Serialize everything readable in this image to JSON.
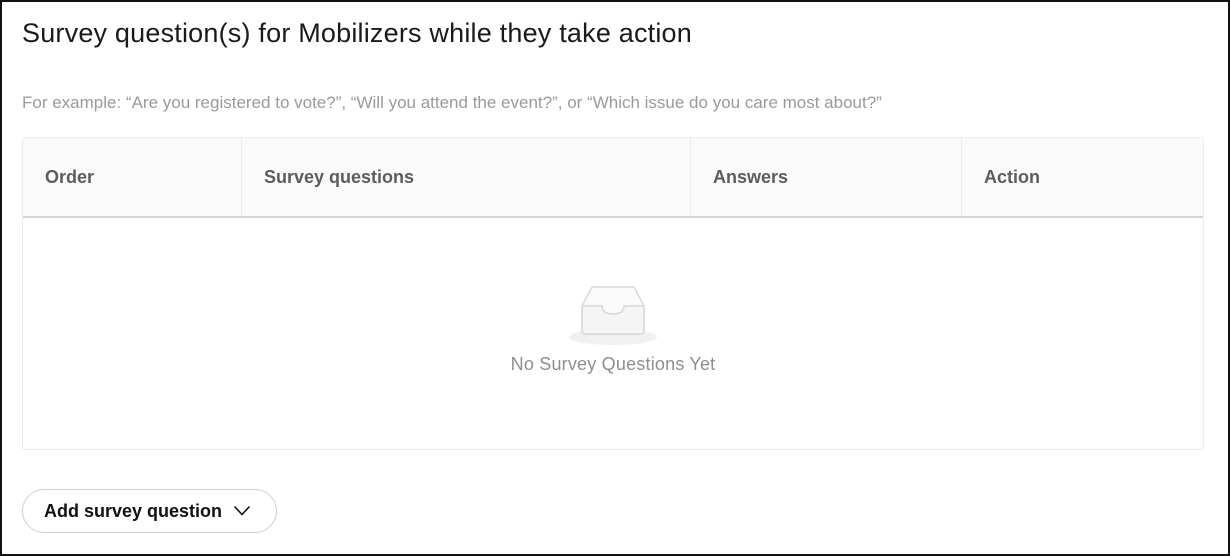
{
  "section": {
    "title": "Survey question(s) for Mobilizers while they take action",
    "hint": "For example: “Are you registered to vote?”, “Will you attend the event?”, or “Which issue do you care most about?”"
  },
  "table": {
    "columns": [
      {
        "label": "Order"
      },
      {
        "label": "Survey questions"
      },
      {
        "label": "Answers"
      },
      {
        "label": "Action"
      }
    ],
    "rows": [],
    "empty_text": "No Survey Questions Yet",
    "empty_icon": "inbox-tray-icon"
  },
  "add_button": {
    "label": "Add survey question",
    "icon": "chevron-down-icon"
  }
}
